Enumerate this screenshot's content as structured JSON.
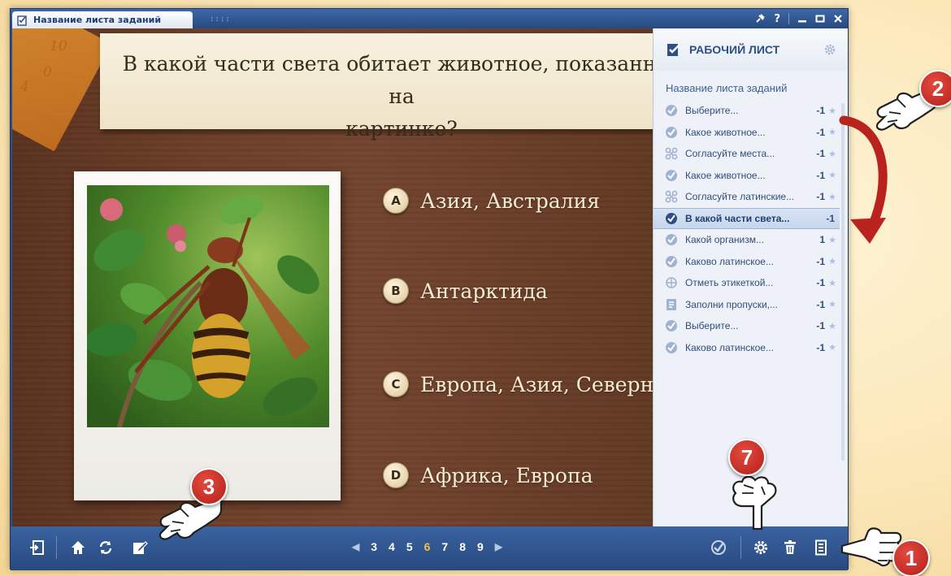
{
  "window": {
    "tab_title": "Название листа заданий",
    "grip": "::::"
  },
  "question": {
    "text": "В какой части света обитает животное, показанное на\nкартинке?"
  },
  "answers": [
    {
      "letter": "A",
      "text": "Азия, Австралия"
    },
    {
      "letter": "B",
      "text": "Антарктида"
    },
    {
      "letter": "C",
      "text": "Европа, Азия, Северная"
    },
    {
      "letter": "D",
      "text": "Африка, Европа"
    }
  ],
  "ruler_marks": [
    "10",
    "0",
    "4"
  ],
  "sidebar": {
    "header": "РАБОЧИЙ ЛИСТ",
    "sheet_title": "Название листа заданий",
    "tasks": [
      {
        "icon": "check-icon",
        "label": "Выберите...",
        "score": "-1"
      },
      {
        "icon": "check-icon",
        "label": "Какое животное...",
        "score": "-1"
      },
      {
        "icon": "match-icon",
        "label": "Согласуйте места...",
        "score": "-1"
      },
      {
        "icon": "check-icon",
        "label": "Какое животное...",
        "score": "-1"
      },
      {
        "icon": "match-icon",
        "label": "Согласуйте латинские...",
        "score": "-1"
      },
      {
        "icon": "check-icon",
        "label": "В какой части света...",
        "score": "-1",
        "active": true
      },
      {
        "icon": "check-icon",
        "label": "Какой организм...",
        "score": "1"
      },
      {
        "icon": "check-icon",
        "label": "Каково латинское...",
        "score": "-1"
      },
      {
        "icon": "label-icon",
        "label": "Отметь этикеткой...",
        "score": "-1"
      },
      {
        "icon": "fill-blank-icon",
        "label": "Заполни пропуски,...",
        "score": "-1"
      },
      {
        "icon": "check-icon",
        "label": "Выберите...",
        "score": "-1"
      },
      {
        "icon": "check-icon",
        "label": "Каково латинское...",
        "score": "-1"
      }
    ]
  },
  "pager": {
    "pages": [
      "3",
      "4",
      "5",
      "6",
      "7",
      "8",
      "9"
    ],
    "current": "6"
  },
  "callouts": {
    "c1": "1",
    "c2": "2",
    "c3": "3",
    "c7": "7"
  },
  "colors": {
    "accent": "#2d4f86",
    "wood": "#6e4029",
    "callout": "#c62a24",
    "current_page": "#f2c14a"
  }
}
